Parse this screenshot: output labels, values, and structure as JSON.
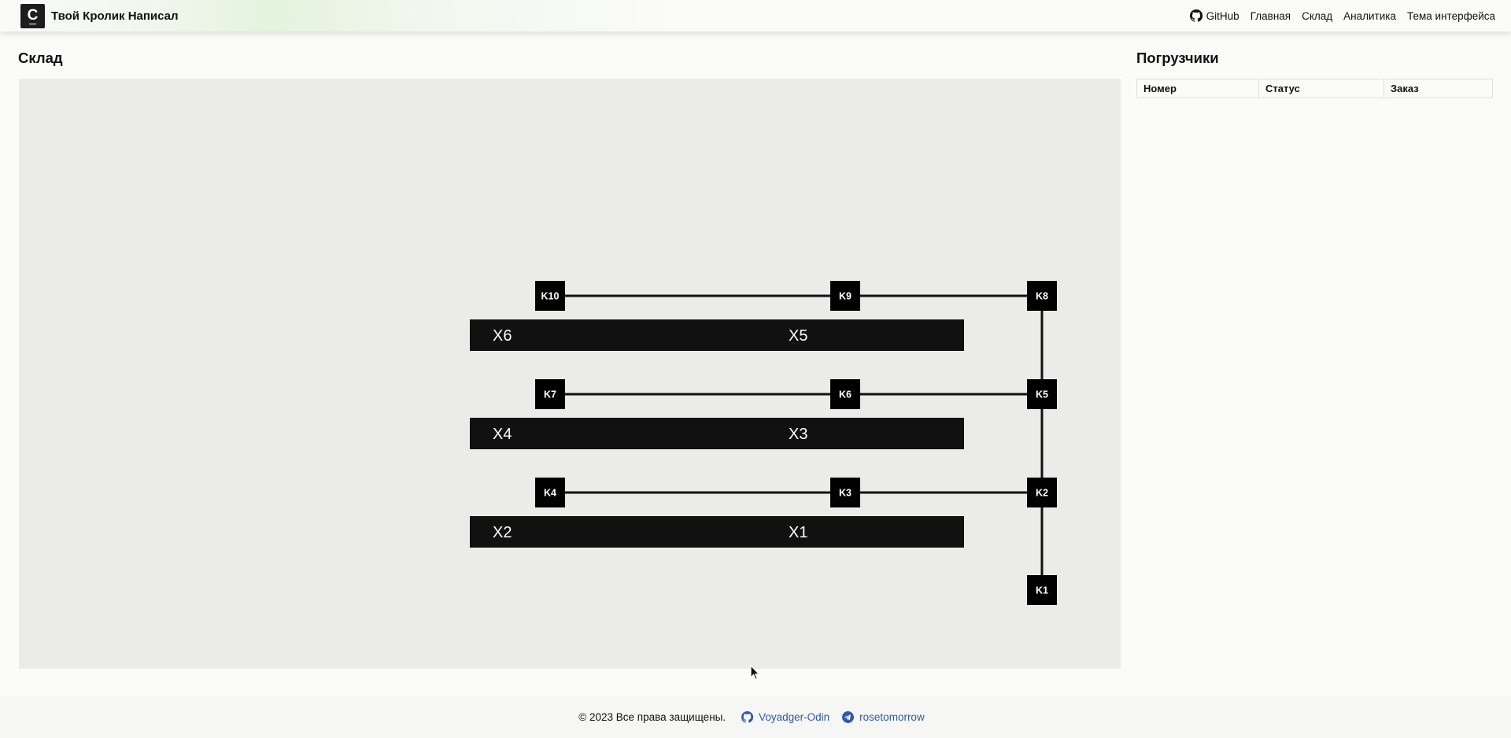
{
  "navbar": {
    "logo_glyph": "C",
    "brand": "Твой Кролик Написал",
    "links": [
      "GitHub",
      "Главная",
      "Склад",
      "Аналитика",
      "Тема интерфейса"
    ]
  },
  "warehouse": {
    "title": "Склад",
    "shelves": [
      {
        "labels": [
          "X6",
          "X5"
        ]
      },
      {
        "labels": [
          "X4",
          "X3"
        ]
      },
      {
        "labels": [
          "X2",
          "X1"
        ]
      }
    ],
    "nodes": [
      "K1",
      "K2",
      "K3",
      "K4",
      "K5",
      "K6",
      "K7",
      "K8",
      "K9",
      "K10"
    ]
  },
  "loaders": {
    "title": "Погрузчики",
    "columns": [
      "Номер",
      "Статус",
      "Заказ"
    ],
    "rows": []
  },
  "footer": {
    "copyright": "© 2023 Все права защищены.",
    "github_user": "Voyadger-Odin",
    "telegram_user": "rosetomorrow"
  },
  "icons": [
    "github-icon",
    "telegram-icon",
    "cursor-icon"
  ],
  "colors": {
    "link": "#2f5aa8",
    "map_bg": "#ebebea",
    "block": "#111111"
  }
}
